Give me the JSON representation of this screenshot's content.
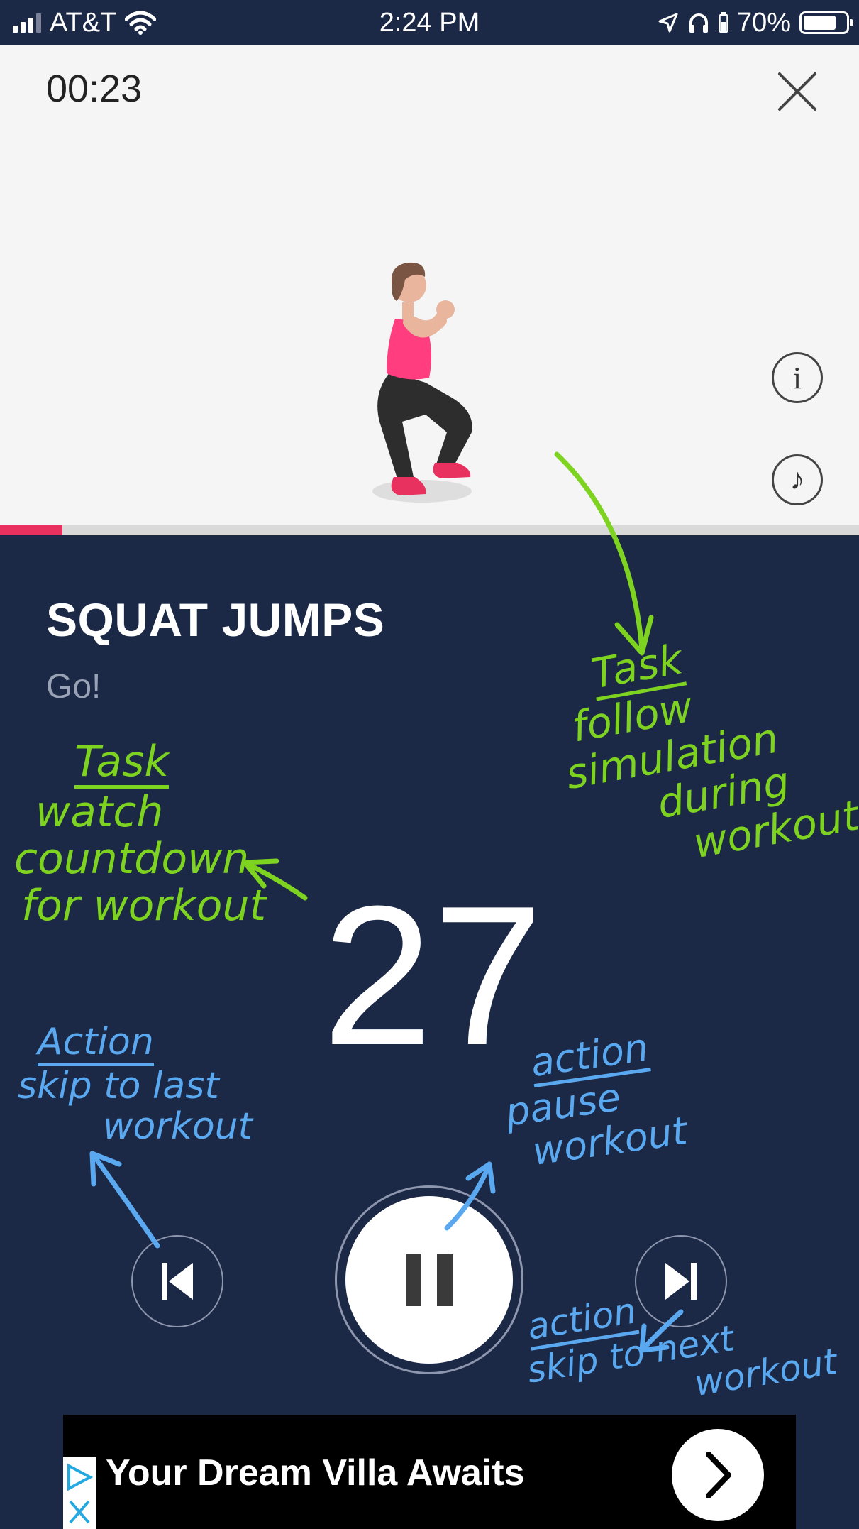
{
  "status_bar": {
    "carrier": "AT&T",
    "time": "2:24 PM",
    "battery": "70%",
    "icons": [
      "signal-icon",
      "wifi-icon",
      "location-icon",
      "headphones-icon",
      "battery-icon"
    ]
  },
  "workout": {
    "timer": "00:23",
    "exercise": "SQUAT JUMPS",
    "status": "Go!",
    "countdown": "27",
    "progress_fraction": 0.073
  },
  "controls": {
    "icons": [
      "close-icon",
      "info-icon",
      "music-icon",
      "previous-icon",
      "pause-icon",
      "next-icon"
    ],
    "info_symbol": "i",
    "music_symbol": "♪"
  },
  "ad": {
    "text": "Your Dream Villa Awaits"
  },
  "annotations": {
    "task_right": {
      "heading": "Task",
      "lines": [
        "follow",
        "simulation",
        "during",
        "workout"
      ]
    },
    "task_left": {
      "heading": "Task",
      "lines": [
        "watch",
        "countdown",
        "for workout"
      ]
    },
    "action_prev": {
      "heading": "Action",
      "lines": [
        "skip to last",
        "workout"
      ]
    },
    "action_pause": {
      "heading": "action",
      "lines": [
        "pause",
        "workout"
      ]
    },
    "action_next": {
      "heading": "action",
      "lines": [
        "skip to next",
        "workout"
      ]
    }
  },
  "colors": {
    "background": "#1b2846",
    "top_panel": "#f5f5f5",
    "progress": "#e8315f",
    "task_annotation": "#7ed321",
    "action_annotation": "#5aa9f0"
  }
}
